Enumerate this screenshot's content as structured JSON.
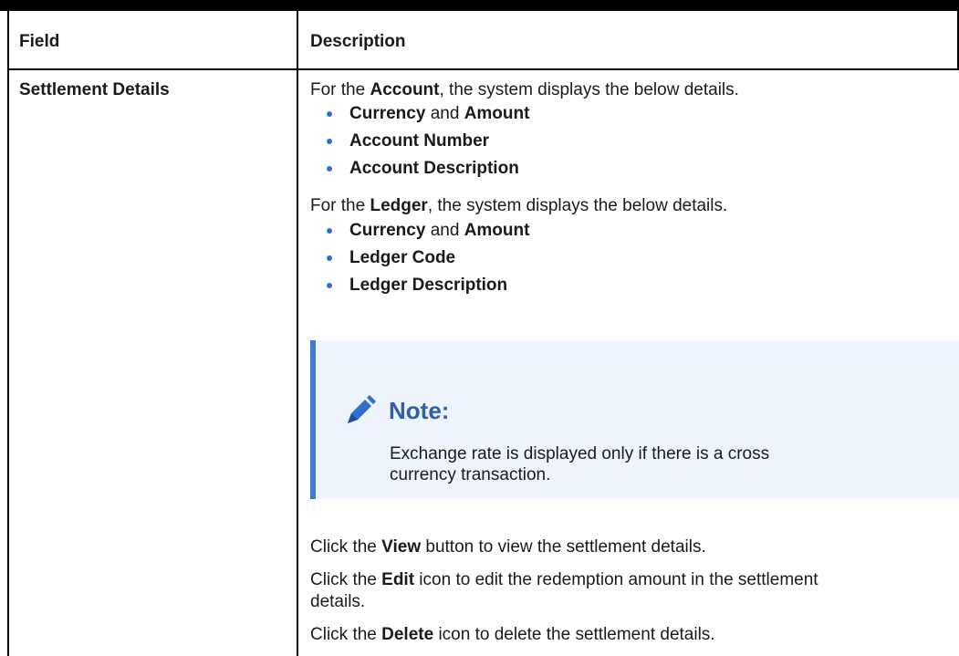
{
  "table": {
    "header": {
      "field": "Field",
      "description": "Description"
    },
    "row": {
      "field": "Settlement Details",
      "account_intro": {
        "pre": "For the ",
        "bold": "Account",
        "post": ", the system displays the below details."
      },
      "account_items": [
        {
          "bold1": "Currency",
          "mid": " and ",
          "bold2": "Amount"
        },
        {
          "bold1": "Account Number",
          "mid": "",
          "bold2": ""
        },
        {
          "bold1": "Account Description",
          "mid": "",
          "bold2": ""
        }
      ],
      "ledger_intro": {
        "pre": "For the ",
        "bold": "Ledger",
        "post": ", the system displays the below details."
      },
      "ledger_items": [
        {
          "bold1": "Currency",
          "mid": " and ",
          "bold2": "Amount"
        },
        {
          "bold1": "Ledger Code",
          "mid": "",
          "bold2": ""
        },
        {
          "bold1": "Ledger Description",
          "mid": "",
          "bold2": ""
        }
      ],
      "note": {
        "title": "Note:",
        "body_line1": "Exchange rate is displayed only if there is a cross",
        "body_line2": "currency transaction.",
        "icon": "pencil-icon"
      },
      "view_line": {
        "pre": "Click the ",
        "bold": "View",
        "post": " button to view the settlement details."
      },
      "edit_line": {
        "pre": "Click the ",
        "bold": "Edit",
        "post": " icon to edit the redemption amount in the settlement",
        "cont": "details."
      },
      "delete_line": {
        "pre": "Click the ",
        "bold": "Delete",
        "post": " icon to delete the settlement details."
      }
    }
  },
  "colors": {
    "bullet": "#2f6fcd",
    "note_bg": "#eef4fb",
    "note_border": "#3f7bd0",
    "note_title": "#2f5fa8"
  }
}
